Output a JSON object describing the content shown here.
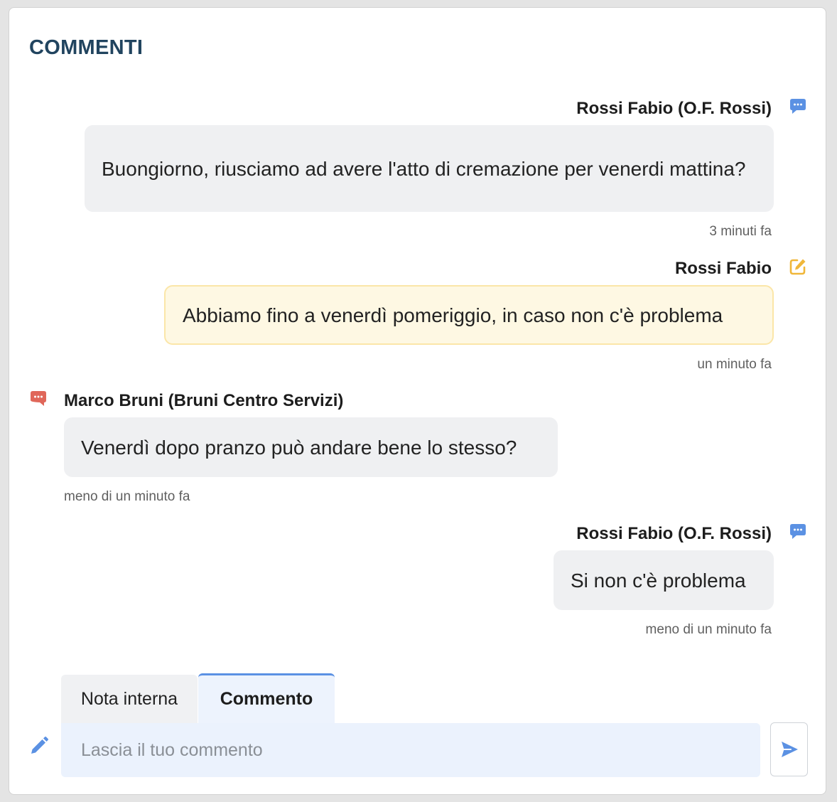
{
  "header": {
    "title": "COMMENTI"
  },
  "comments": [
    {
      "author": "Rossi Fabio (O.F. Rossi)",
      "text": "Buongiorno, riusciamo ad avere l'atto di cremazione per venerdi mattina?",
      "time": "3 minuti fa",
      "kind": "comment",
      "icon": "comment-dots-icon"
    },
    {
      "author": "Rossi Fabio",
      "text": "Abbiamo fino a venerdì pomeriggio, in caso non c'è problema",
      "time": "un minuto fa",
      "kind": "internal-note",
      "icon": "edit-note-icon"
    },
    {
      "author": "Marco Bruni (Bruni Centro Servizi)",
      "text": "Venerdì dopo pranzo può andare bene lo stesso?",
      "time": "meno di un minuto fa",
      "kind": "comment",
      "icon": "comment-dots-icon"
    },
    {
      "author": "Rossi Fabio (O.F. Rossi)",
      "text": "Si non c'è problema",
      "time": "meno di un minuto fa",
      "kind": "comment",
      "icon": "comment-dots-icon"
    }
  ],
  "composer": {
    "tabs": [
      {
        "label": "Nota interna",
        "active": false
      },
      {
        "label": "Commento",
        "active": true
      }
    ],
    "placeholder": "Lascia il tuo commento",
    "value": "",
    "send_icon": "send-icon",
    "pencil_icon": "pencil-icon"
  },
  "colors": {
    "title": "#21445f",
    "own_comment_icon": "#5b91e3",
    "other_comment_icon": "#e0675a",
    "note_icon": "#f0b73a",
    "note_background": "#fef8e3",
    "note_border": "#fbe6a8",
    "bubble_background": "#eff0f2",
    "active_tab_accent": "#5b91e3",
    "input_background": "#ebf2fd"
  }
}
